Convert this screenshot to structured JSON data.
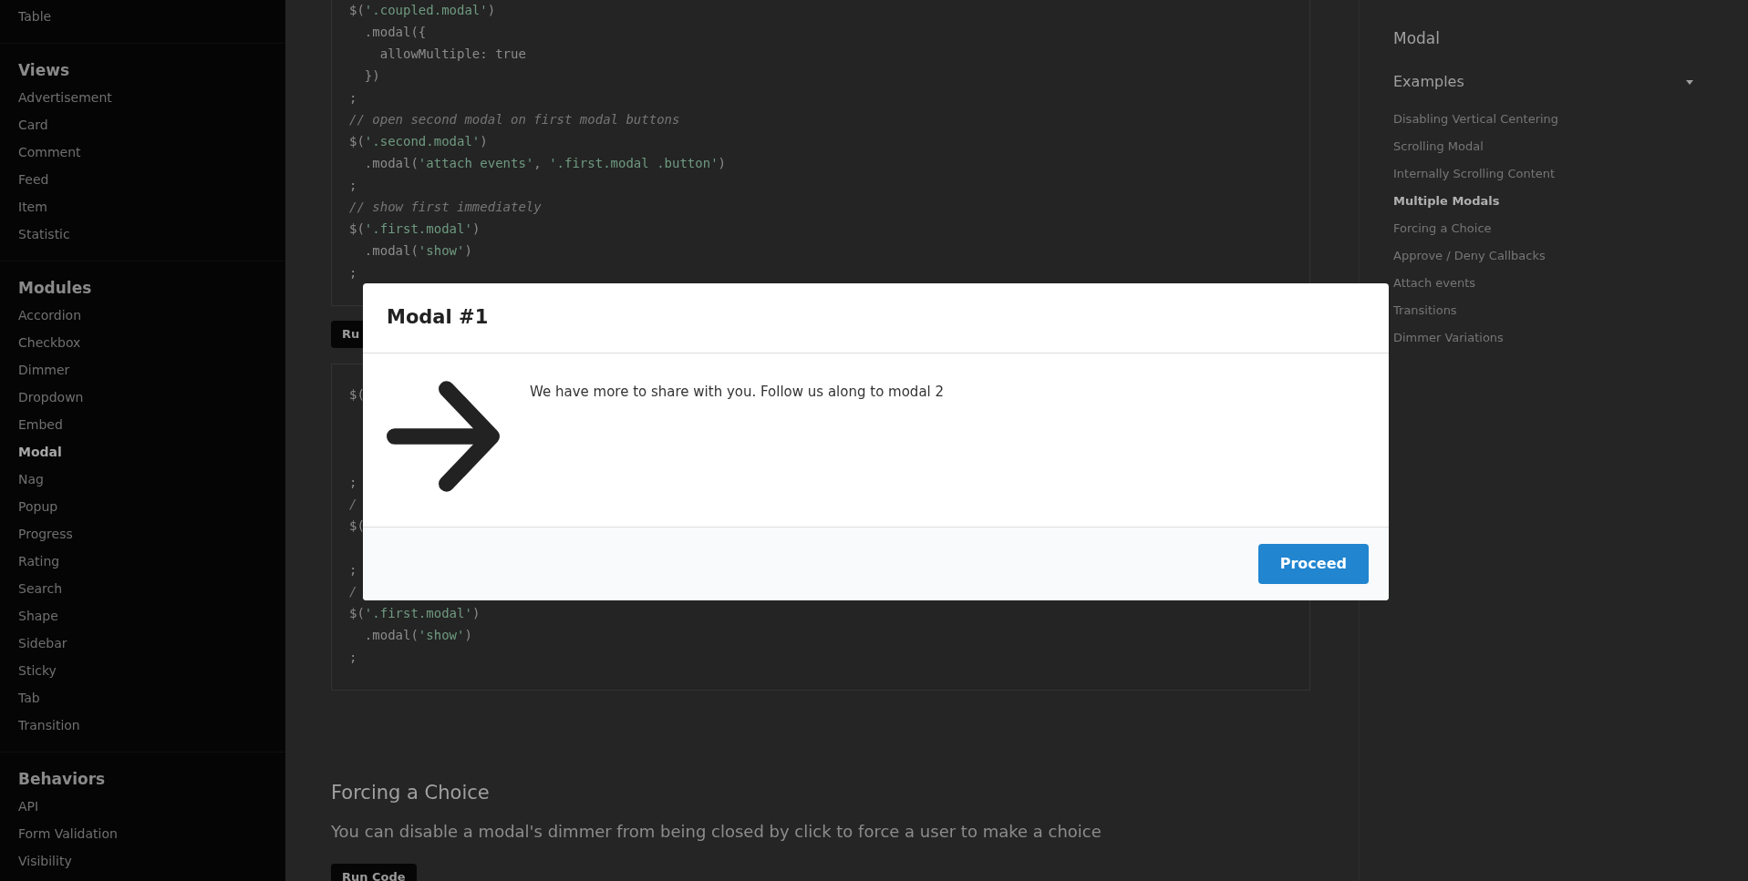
{
  "sidebar": {
    "sections": [
      {
        "items": [
          {
            "label": "Table",
            "selected": false
          }
        ]
      },
      {
        "title": "Views",
        "items": [
          {
            "label": "Advertisement",
            "selected": false
          },
          {
            "label": "Card",
            "selected": false
          },
          {
            "label": "Comment",
            "selected": false
          },
          {
            "label": "Feed",
            "selected": false
          },
          {
            "label": "Item",
            "selected": false
          },
          {
            "label": "Statistic",
            "selected": false
          }
        ]
      },
      {
        "title": "Modules",
        "items": [
          {
            "label": "Accordion",
            "selected": false
          },
          {
            "label": "Checkbox",
            "selected": false
          },
          {
            "label": "Dimmer",
            "selected": false
          },
          {
            "label": "Dropdown",
            "selected": false
          },
          {
            "label": "Embed",
            "selected": false
          },
          {
            "label": "Modal",
            "selected": true
          },
          {
            "label": "Nag",
            "selected": false
          },
          {
            "label": "Popup",
            "selected": false
          },
          {
            "label": "Progress",
            "selected": false
          },
          {
            "label": "Rating",
            "selected": false
          },
          {
            "label": "Search",
            "selected": false
          },
          {
            "label": "Shape",
            "selected": false
          },
          {
            "label": "Sidebar",
            "selected": false
          },
          {
            "label": "Sticky",
            "selected": false
          },
          {
            "label": "Tab",
            "selected": false
          },
          {
            "label": "Transition",
            "selected": false
          }
        ]
      },
      {
        "title": "Behaviors",
        "items": [
          {
            "label": "API",
            "selected": false
          },
          {
            "label": "Form Validation",
            "selected": false
          },
          {
            "label": "Visibility",
            "selected": false
          }
        ]
      }
    ]
  },
  "content": [
    {
      "kind": "code",
      "lines": [
        {
          "kind": "text",
          "segments": [
            {
              "kind": "plain",
              "text": "$("
            },
            {
              "kind": "string",
              "text": "'.coupled.modal'"
            },
            {
              "kind": "plain",
              "text": ")"
            }
          ]
        },
        {
          "kind": "text",
          "segments": [
            {
              "kind": "plain",
              "text": "  .modal({"
            }
          ]
        },
        {
          "kind": "text",
          "segments": [
            {
              "kind": "plain",
              "text": "    allowMultiple: true"
            }
          ]
        },
        {
          "kind": "text",
          "segments": [
            {
              "kind": "plain",
              "text": "  })"
            }
          ]
        },
        {
          "kind": "text",
          "segments": [
            {
              "kind": "plain",
              "text": ";"
            }
          ]
        },
        {
          "kind": "text",
          "segments": [
            {
              "kind": "comment",
              "text": "// open second modal on first modal buttons"
            }
          ]
        },
        {
          "kind": "text",
          "segments": [
            {
              "kind": "plain",
              "text": "$("
            },
            {
              "kind": "string",
              "text": "'.second.modal'"
            },
            {
              "kind": "plain",
              "text": ")"
            }
          ]
        },
        {
          "kind": "text",
          "segments": [
            {
              "kind": "plain",
              "text": "  .modal("
            },
            {
              "kind": "string",
              "text": "'attach events'"
            },
            {
              "kind": "plain",
              "text": ", "
            },
            {
              "kind": "string",
              "text": "'.first.modal .button'"
            },
            {
              "kind": "plain",
              "text": ")"
            }
          ]
        },
        {
          "kind": "text",
          "segments": [
            {
              "kind": "plain",
              "text": ";"
            }
          ]
        },
        {
          "kind": "text",
          "segments": [
            {
              "kind": "comment",
              "text": "// show first immediately"
            }
          ]
        },
        {
          "kind": "text",
          "segments": [
            {
              "kind": "plain",
              "text": "$("
            },
            {
              "kind": "string",
              "text": "'.first.modal'"
            },
            {
              "kind": "plain",
              "text": ")"
            }
          ]
        },
        {
          "kind": "text",
          "segments": [
            {
              "kind": "plain",
              "text": "  .modal("
            },
            {
              "kind": "string",
              "text": "'show'"
            },
            {
              "kind": "plain",
              "text": ")"
            }
          ]
        },
        {
          "kind": "text",
          "segments": [
            {
              "kind": "plain",
              "text": ";"
            }
          ]
        }
      ]
    },
    {
      "kind": "button",
      "label": "Ru"
    },
    {
      "kind": "code",
      "lines": [
        {
          "kind": "text",
          "segments": [
            {
              "kind": "plain",
              "text": "$("
            }
          ]
        },
        {
          "kind": "covered"
        },
        {
          "kind": "covered"
        },
        {
          "kind": "covered"
        },
        {
          "kind": "text",
          "segments": [
            {
              "kind": "plain",
              "text": ";"
            }
          ]
        },
        {
          "kind": "text",
          "segments": [
            {
              "kind": "comment",
              "text": "/"
            }
          ]
        },
        {
          "kind": "text",
          "segments": [
            {
              "kind": "plain",
              "text": "$("
            }
          ]
        },
        {
          "kind": "covered"
        },
        {
          "kind": "text",
          "segments": [
            {
              "kind": "plain",
              "text": ";"
            }
          ]
        },
        {
          "kind": "text",
          "segments": [
            {
              "kind": "comment",
              "text": "/"
            }
          ]
        },
        {
          "kind": "text",
          "segments": [
            {
              "kind": "plain",
              "text": "$("
            },
            {
              "kind": "string",
              "text": "'.first.modal'"
            },
            {
              "kind": "plain",
              "text": ")"
            }
          ]
        },
        {
          "kind": "text",
          "segments": [
            {
              "kind": "plain",
              "text": "  .modal("
            },
            {
              "kind": "string",
              "text": "'show'"
            },
            {
              "kind": "plain",
              "text": ")"
            }
          ]
        },
        {
          "kind": "text",
          "segments": [
            {
              "kind": "plain",
              "text": ";"
            }
          ]
        }
      ]
    },
    {
      "kind": "heading",
      "text": "Forcing a Choice"
    },
    {
      "kind": "paragraph",
      "text": "You can disable a modal's dimmer from being closed by click to force a user to make a choice"
    },
    {
      "kind": "button",
      "label": "Run Code"
    }
  ],
  "toc": {
    "title": "Modal",
    "group": {
      "title": "Examples",
      "expanded": true,
      "items": [
        {
          "label": "Disabling Vertical Centering",
          "selected": false
        },
        {
          "label": "Scrolling Modal",
          "selected": false
        },
        {
          "label": "Internally Scrolling Content",
          "selected": false
        },
        {
          "label": "Multiple Modals",
          "selected": true
        },
        {
          "label": "Forcing a Choice",
          "selected": false
        },
        {
          "label": "Approve / Deny Callbacks",
          "selected": false
        },
        {
          "label": "Attach events",
          "selected": false
        },
        {
          "label": "Transitions",
          "selected": false
        },
        {
          "label": "Dimmer Variations",
          "selected": false
        }
      ]
    }
  },
  "modal": {
    "title": "Modal #1",
    "text": "We have more to share with you. Follow us along to modal 2",
    "button": "Proceed"
  }
}
